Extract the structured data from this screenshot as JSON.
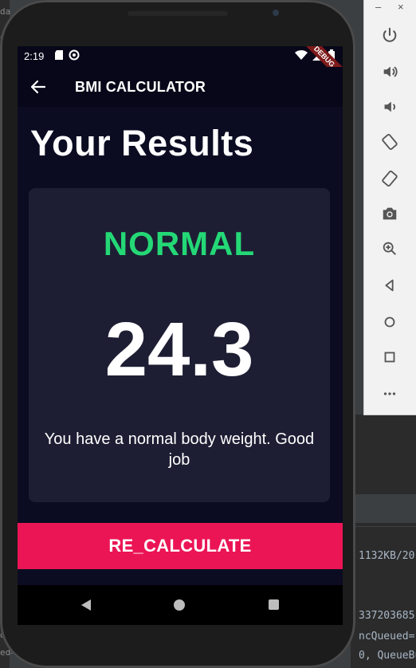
{
  "ide": {
    "left_fragments": [
      "da",
      "e",
      "C",
      "e",
      "s",
      "o",
      "e",
      "e",
      "e",
      "e",
      "c",
      "o",
      "w",
      "n",
      "e",
      "e",
      "e",
      "d=",
      "ed="
    ],
    "right_lines": [
      "1132KB/20",
      "337203685",
      "ncQueued=",
      "0, QueueBuf"
    ]
  },
  "emulator_toolbar": {
    "minimize": "–",
    "close": "×",
    "buttons": [
      "power-icon",
      "volume-up-icon",
      "volume-down-icon",
      "rotate-left-icon",
      "rotate-right-icon",
      "camera-icon",
      "zoom-icon",
      "back-icon",
      "home-icon",
      "overview-icon",
      "more-icon"
    ]
  },
  "status_bar": {
    "time": "2:19",
    "debug_label": "DEBUG"
  },
  "app_bar": {
    "title": "BMI CALCULATOR"
  },
  "page": {
    "title": "Your Results"
  },
  "result": {
    "status": "NORMAL",
    "value": "24.3",
    "message": "You have a normal body weight. Good job"
  },
  "recalculate_button": {
    "label": "RE_CALCULATE"
  },
  "colors": {
    "background": "#0b0c22",
    "card": "#1d1e33",
    "status_green": "#24d876",
    "button_pink": "#eb1555"
  }
}
